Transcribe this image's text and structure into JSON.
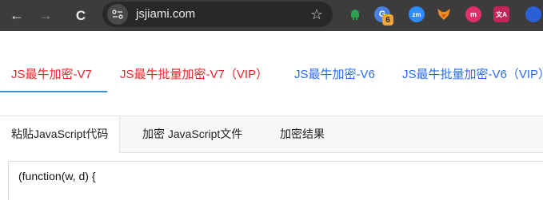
{
  "browser": {
    "url": "jsjiami.com",
    "back_glyph": "←",
    "forward_glyph": "→",
    "reload_glyph": "C",
    "star_glyph": "☆",
    "extensions": [
      {
        "icon": "android-icon",
        "label": ""
      },
      {
        "icon": "g-icon",
        "label": "",
        "badge": "6"
      },
      {
        "icon": "zoom-icon",
        "label": "zm"
      },
      {
        "icon": "fox-icon",
        "label": ""
      },
      {
        "icon": "m-icon",
        "label": "m"
      },
      {
        "icon": "translate-icon",
        "label": "文A"
      }
    ]
  },
  "version_tabs": [
    {
      "label": "JS最牛加密-V7",
      "color": "red",
      "active": true
    },
    {
      "label": "JS最牛批量加密-V7（VIP）",
      "color": "red",
      "active": false
    },
    {
      "label": "JS最牛加密-V6",
      "color": "blue",
      "active": false
    },
    {
      "label": "JS最牛批量加密-V6（VIP）",
      "color": "blue",
      "active": false
    }
  ],
  "panel_tabs": [
    {
      "label": "粘贴JavaScript代码",
      "active": true
    },
    {
      "label": "加密 JavaScript文件",
      "active": false
    },
    {
      "label": "加密结果",
      "active": false
    }
  ],
  "editor": {
    "first_line": "(function(w, d) {"
  },
  "colors": {
    "red": "#e8232a",
    "blue": "#2c6cf0",
    "underline": "#3a8fd9",
    "toolbar": "#3c3c3c"
  }
}
